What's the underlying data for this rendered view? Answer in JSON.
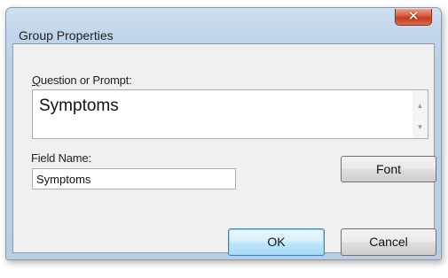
{
  "dialog": {
    "title": "Group Properties",
    "close_icon": "close-icon"
  },
  "prompt": {
    "label_underlined": "Q",
    "label_rest": "uestion or Prompt:",
    "value": "Symptoms",
    "scroll_up_icon": "scroll-up-arrow-icon",
    "scroll_down_icon": "scroll-down-arrow-icon"
  },
  "field": {
    "label": "Field Name:",
    "value": "Symptoms"
  },
  "buttons": {
    "font_label": "Font",
    "ok_label": "OK",
    "cancel_label": "Cancel"
  },
  "colors": {
    "frame": "#c2d5ea",
    "close_button": "#c43b22",
    "default_button_border": "#3c7fb1"
  }
}
